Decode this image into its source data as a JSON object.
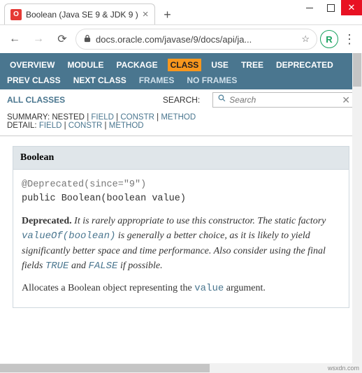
{
  "window": {
    "tab_title": "Boolean (Java SE 9 & JDK 9 )",
    "favicon_letter": "O",
    "url_display": "docs.oracle.com/javase/9/docs/api/ja...",
    "avatar_letter": "R"
  },
  "nav": {
    "tabs": [
      "OVERVIEW",
      "MODULE",
      "PACKAGE",
      "CLASS",
      "USE",
      "TREE",
      "DEPRECATED"
    ],
    "selected_tab": "CLASS",
    "prev": "PREV CLASS",
    "next": "NEXT CLASS",
    "frames": "FRAMES",
    "noframes": "NO FRAMES",
    "all_classes": "ALL CLASSES",
    "search_label": "SEARCH:",
    "search_placeholder": "Search"
  },
  "meta": {
    "summary_label": "SUMMARY:",
    "summary_items": [
      "NESTED",
      "FIELD",
      "CONSTR",
      "METHOD"
    ],
    "detail_label": "DETAIL:",
    "detail_items": [
      "FIELD",
      "CONSTR",
      "METHOD"
    ]
  },
  "doc": {
    "class_name": "Boolean",
    "annotation": "@Deprecated(since=\"9\")",
    "signature": "public Boolean(boolean value)",
    "deprecated_label": "Deprecated.",
    "deprecated_text_1": "It is rarely appropriate to use this constructor. The static factory ",
    "deprecated_code_1": "valueOf(boolean)",
    "deprecated_text_2": " is generally a better choice, as it is likely to yield significantly better space and time performance. Also consider using the final fields ",
    "deprecated_code_2": "TRUE",
    "deprecated_text_3": " and ",
    "deprecated_code_3": "FALSE",
    "deprecated_text_4": " if possible.",
    "body_1": "Allocates a Boolean object representing the ",
    "body_code": "value",
    "body_2": " argument."
  },
  "watermark": "wsxdn.com"
}
